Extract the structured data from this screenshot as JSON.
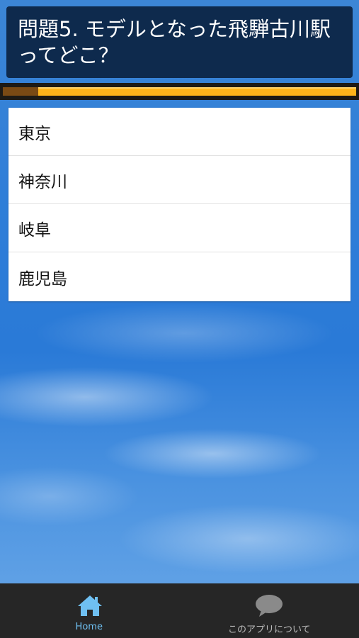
{
  "question": {
    "text": "問題5. モデルとなった飛騨古川駅ってどこ？"
  },
  "timer": {
    "elapsed_fraction": 0.1,
    "colors": {
      "remaining": "#ffb41a",
      "elapsed": "#7a4a14"
    }
  },
  "answers": [
    {
      "label": "東京"
    },
    {
      "label": "神奈川"
    },
    {
      "label": "岐阜"
    },
    {
      "label": "鹿児島"
    }
  ],
  "bottom_nav": {
    "items": [
      {
        "label": "Home",
        "icon": "home-icon",
        "active": true,
        "color": "#6fc0f2"
      },
      {
        "label": "このアプリについて",
        "icon": "speech-bubble-icon",
        "active": false,
        "color": "#bbbbbb"
      }
    ]
  }
}
